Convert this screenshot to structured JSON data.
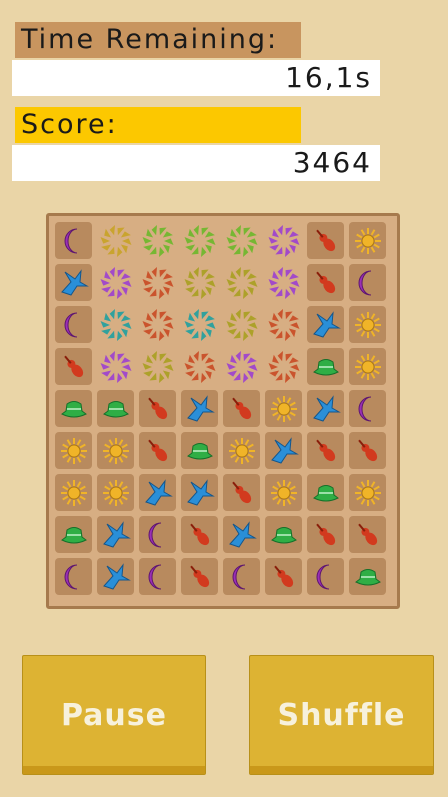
{
  "hud": {
    "time_label": "Time Remaining:",
    "time_value": "16,1s",
    "score_label": "Score:",
    "score_value": "3464"
  },
  "buttons": {
    "pause_label": "Pause",
    "shuffle_label": "Shuffle"
  },
  "board": {
    "rows": [
      [
        "moon",
        "burst-gold",
        "burst-green",
        "burst-green",
        "burst-green",
        "burst-purple",
        "violin",
        "sun"
      ],
      [
        "bird",
        "burst-purple",
        "burst-red",
        "burst-olive",
        "burst-olive",
        "burst-purple",
        "violin",
        "moon"
      ],
      [
        "moon",
        "burst-teal",
        "burst-red",
        "burst-teal",
        "burst-olive",
        "burst-red",
        "bird",
        "sun"
      ],
      [
        "violin",
        "burst-purple",
        "burst-olive",
        "burst-red",
        "burst-purple",
        "burst-red",
        "hat",
        "sun"
      ],
      [
        "hat",
        "hat",
        "violin",
        "bird",
        "violin",
        "sun",
        "bird",
        "moon"
      ],
      [
        "sun",
        "sun",
        "violin",
        "hat",
        "sun",
        "bird",
        "violin",
        "violin"
      ],
      [
        "sun",
        "sun",
        "bird",
        "bird",
        "violin",
        "sun",
        "hat",
        "sun"
      ],
      [
        "hat",
        "bird",
        "moon",
        "violin",
        "bird",
        "hat",
        "violin",
        "violin"
      ],
      [
        "moon",
        "bird",
        "moon",
        "violin",
        "moon",
        "violin",
        "moon",
        "hat"
      ]
    ]
  },
  "colors": {
    "background": "#ead5a7",
    "board": "#d7ae83",
    "cell": "#b88a5e",
    "time_label_bg": "#c8955f",
    "score_label_bg": "#fcc800",
    "button": "#ddb333",
    "moon": "#9b2fb6",
    "sun": "#f0b428",
    "violin": "#d23a1e",
    "bird": "#2a8fd8",
    "hat": "#2fae45"
  }
}
